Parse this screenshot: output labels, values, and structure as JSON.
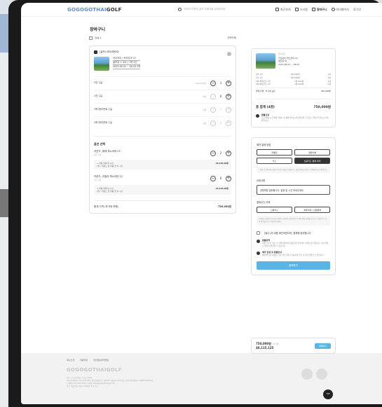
{
  "header": {
    "logo_main": "GOGOGOTHAI",
    "logo_tail": "GOLF",
    "search_placeholder": "태국의 여행지 골프 여행지를 검색하세요",
    "nav": [
      {
        "label": "최근조회"
      },
      {
        "label": "스크랩"
      },
      {
        "label": "장바구니",
        "active": true
      },
      {
        "label": "마이페이지"
      },
      {
        "label": "로그인"
      }
    ]
  },
  "page": {
    "title": "장바구니"
  },
  "cart": {
    "select_all": "전체 1",
    "delete_selected": "선택삭제",
    "product_category": "[골프] 태국/파타야",
    "product_name": "카오야이 / 카오야이 CC",
    "product_sub": "골프장 + 숙소 / 1박 2인",
    "product_dates": "2023.08.01 ~ 08.03 2박",
    "options": [
      {
        "label": "2인 1실",
        "price": "500,000원",
        "qty": "1"
      },
      {
        "label": "1인 1실",
        "price": "0원",
        "qty": "0"
      },
      {
        "label": "1박 에이전트 1실",
        "price": "0원",
        "qty": "1"
      },
      {
        "label": "2박 에이전트 1실",
        "price": "0원",
        "qty": "0"
      }
    ],
    "addon_title": "옵션 선택",
    "addons": [
      {
        "name": "카운드, 왕래 파노라마 CC",
        "sub": "1인 기준",
        "qty": "2",
        "box_title": "+ 이용 날짜 및 시간",
        "box_sub": "1일 / 라운드 및 이동 및 후 시간",
        "box_price": "48,165,00원"
      },
      {
        "name": "카운드, 카일라 파노라마 CC",
        "sub": "1인 기준",
        "qty": "0",
        "box_title": "+ 이용 날짜 및 시간",
        "box_sub": "1일 / 라운드 및 이동 및 후 시간",
        "box_price": "48,165,00원"
      }
    ],
    "total_label": "합계 가격 (부가세 포함)",
    "total_value": "750,000원"
  },
  "summary": {
    "tag": "태국/골프",
    "name": "카오야이 파노라마 CC",
    "sub": "골프장 외",
    "date": "2023.08.01 ~ 08.03",
    "lines": [
      {
        "k": "2인 1실",
        "v": "1박 500원",
        "c": "2개"
      },
      {
        "k": "1인 1실",
        "v": "1박 500원",
        "c": "0개"
      },
      {
        "k": "1박 에이전트 1실",
        "v": "1박 500원",
        "c": "1개"
      },
      {
        "k": "2박 에이전트 1실",
        "v": "1박 500원",
        "c": "0개"
      }
    ],
    "line_total_k": "결제 금액 · 부가세 포함",
    "line_total_v": "330,000원",
    "total_label": "총 합계 (4명)",
    "total_value": "750,000원",
    "note_title": "환불규정",
    "note_text": "요금 변동 시 금액이 바뀌는 점 양해 부탁드리며 변경될 수 있으니 결제 전 반드시 확인 바랍니다."
  },
  "payment": {
    "method_label": "예약 결제 방법",
    "methods": [
      "무통장",
      "계좌이체",
      "카드",
      "신용카드 결제 대리"
    ],
    "method_note": "* 결제 수단에 따라 결제 수수료가 다를 수 있습니다. 결제 방법을 선택 후 진행해 주시기 바랍니다.",
    "request_label": "요청사항",
    "request_value": "공항픽업 필요합니다. 일정 및 시간 보내주세요.",
    "receipt_label": "결제수단 선택",
    "receipts": [
      "신용카드",
      "계좌이체 / 간편결제"
    ],
    "receipt_note": "선택하신 결제수단에 따라 결제가 진행되며 결제 완료 후 예약 확정 안내를 받으실 수 있습니다. 결제 내용을 반드시 확인해 주세요.",
    "agree_label": "[필수] 위 내용 확인하였으며, 결제에 동의합니다.",
    "notice1_title": "환불정책",
    "notice1_text": "이용 7일 전 취소 시 전액 환불되며 이용 3일 전부터는 환불이 불가합니다. 기상 악화 시 일정이 변경될 수 있습니다.",
    "notice2_title": "예약 변경 및 환불안내",
    "notice2_text": "예약 변경은 이용일 기준 3일 전까지 가능하며 추가 요금이 발생할 수 있습니다.",
    "cta": "결제하기"
  },
  "bottom": {
    "price": "750,000원",
    "price_sub": "· 총 4명",
    "price_line2": "48,115,125",
    "button": "결제하기"
  },
  "footer": {
    "links": [
      "회사소개",
      "이용약관",
      "개인정보처리방침"
    ],
    "logo": "GOGOGOTHAIGOLF",
    "lines": [
      "상호: 고고고타이골프 | 대표: 박주환",
      "사업자등록번호: 123-45-67890 | 통신판매업신고: 제2023-서울강남-01234호 | 관광사업등록번호: 제2023-000012호",
      "고객센터: 02-1234-5678 | 이메일: help@gogogothaigolf.com",
      "주소: 서울특별시 강남구 테헤란로 123, 5층"
    ],
    "top_label": "TOP"
  }
}
